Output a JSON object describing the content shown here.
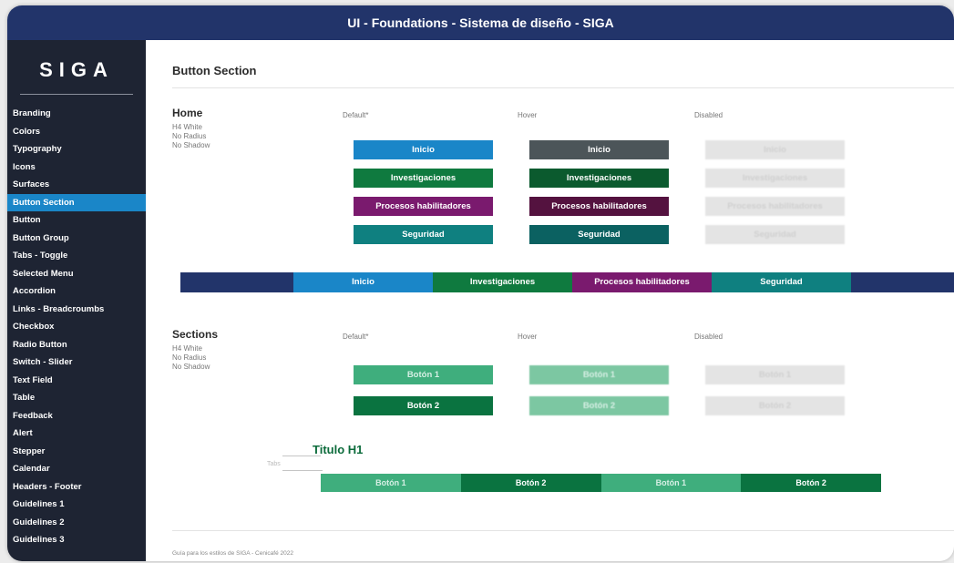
{
  "window": {
    "title": "UI - Foundations - Sistema de diseño - SIGA"
  },
  "logo": {
    "text": "SIGA"
  },
  "sidebar": {
    "items": [
      {
        "label": "Branding"
      },
      {
        "label": "Colors"
      },
      {
        "label": "Typography"
      },
      {
        "label": "Icons"
      },
      {
        "label": "Surfaces"
      },
      {
        "label": "Button Section",
        "active": true
      },
      {
        "label": "Button"
      },
      {
        "label": "Button Group"
      },
      {
        "label": "Tabs - Toggle"
      },
      {
        "label": "Selected Menu"
      },
      {
        "label": "Accordion"
      },
      {
        "label": "Links - Breadcroumbs"
      },
      {
        "label": "Checkbox"
      },
      {
        "label": "Radio Button"
      },
      {
        "label": "Switch - Slider"
      },
      {
        "label": "Text Field"
      },
      {
        "label": "Table"
      },
      {
        "label": "Feedback"
      },
      {
        "label": "Alert"
      },
      {
        "label": "Stepper"
      },
      {
        "label": "Calendar"
      },
      {
        "label": "Headers - Footer"
      },
      {
        "label": "Guidelines 1"
      },
      {
        "label": "Guidelines 2"
      },
      {
        "label": "Guidelines 3"
      }
    ]
  },
  "main": {
    "title": "Button Section",
    "home": {
      "title": "Home",
      "notes": [
        "H4 White",
        "No Radius",
        "No Shadow"
      ],
      "columns": {
        "default": "Default*",
        "hover": "Hover",
        "disabled": "Disabled"
      },
      "buttons": [
        {
          "label": "Inicio",
          "default_color": "#1a86c8",
          "hover_color": "#4c5559"
        },
        {
          "label": "Investigaciones",
          "default_color": "#0f7a3f",
          "hover_color": "#0b5a2e"
        },
        {
          "label": "Procesos habilitadores",
          "default_color": "#7a1a6e",
          "hover_color": "#54123f"
        },
        {
          "label": "Seguridad",
          "default_color": "#0f8080",
          "hover_color": "#0b6161"
        }
      ]
    },
    "navbar": {
      "items": [
        {
          "label": "Inicio",
          "color": "#1a86c8"
        },
        {
          "label": "Investigaciones",
          "color": "#0f7a3f"
        },
        {
          "label": "Procesos habilitadores",
          "color": "#7a1a6e"
        },
        {
          "label": "Seguridad",
          "color": "#0f8080"
        }
      ]
    },
    "sections": {
      "title": "Sections",
      "notes": [
        "H4 White",
        "No Radius",
        "No Shadow"
      ],
      "columns": {
        "default": "Default*",
        "hover": "Hover",
        "disabled": "Disabled"
      },
      "buttons": [
        {
          "label": "Botón 1",
          "default_color": "#3fae7d",
          "hover_color": "#7cc7a2"
        },
        {
          "label": "Botón 2",
          "default_color": "#0a7340",
          "hover_color": "#7cc7a2"
        }
      ]
    },
    "example": {
      "title": "Titulo H1",
      "small_label": "Tabs",
      "tabs": [
        {
          "label": "Botón 1",
          "color": "#3fae7d"
        },
        {
          "label": "Botón 2",
          "color": "#0a7340"
        },
        {
          "label": "Botón 1",
          "color": "#3fae7d"
        },
        {
          "label": "Botón 2",
          "color": "#0a7340"
        }
      ]
    },
    "footer": "Guía para los estilos de SIGA - Cenicafé 2022"
  }
}
